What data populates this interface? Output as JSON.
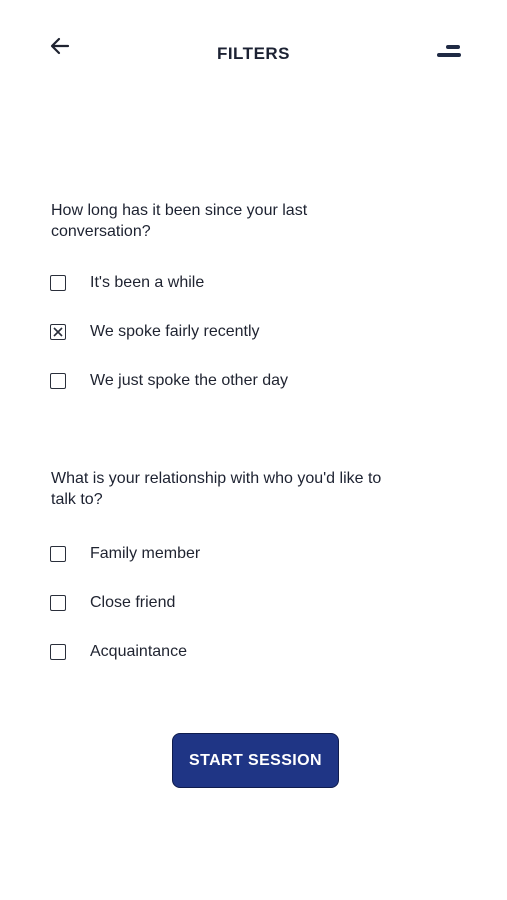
{
  "header": {
    "title": "FILTERS",
    "back_icon": "arrow-left-icon",
    "menu_icon": "menu-lines-icon"
  },
  "questions": [
    {
      "text": "How long has it been since your last conversation?",
      "options": [
        {
          "label": "It's been a while",
          "checked": false
        },
        {
          "label": "We spoke fairly recently",
          "checked": true
        },
        {
          "label": "We just spoke the other day",
          "checked": false
        }
      ]
    },
    {
      "text": "What is your relationship with who you'd like to talk to?",
      "options": [
        {
          "label": "Family member",
          "checked": false
        },
        {
          "label": "Close friend",
          "checked": false
        },
        {
          "label": "Acquaintance",
          "checked": false
        }
      ]
    }
  ],
  "start_button": {
    "label": "START SESSION"
  },
  "colors": {
    "primary_button": "#1f3585",
    "text": "#1f2330"
  }
}
